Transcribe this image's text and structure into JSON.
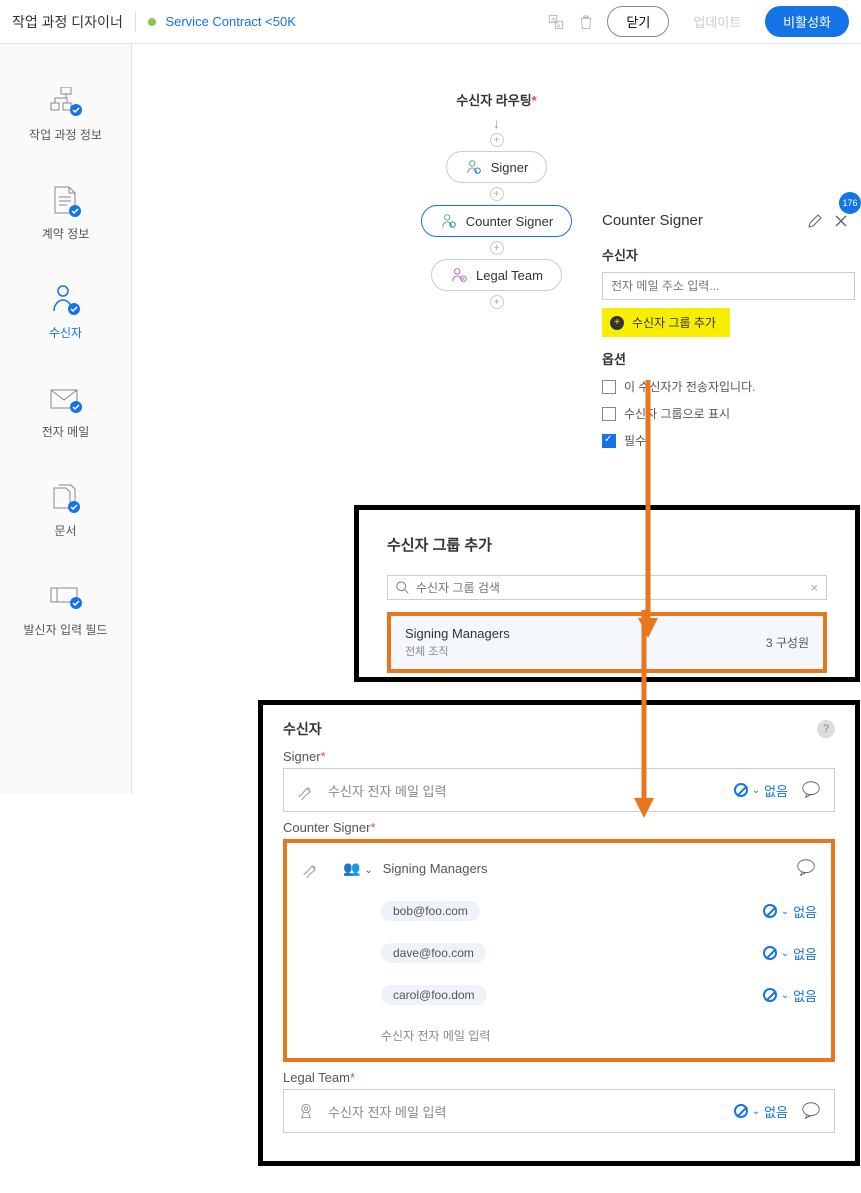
{
  "topbar": {
    "title": "작업 과정 디자이너",
    "service_name": "Service Contract <50K",
    "close_label": "닫기",
    "update_label": "업데이트",
    "disable_label": "비활성화"
  },
  "sidebar": {
    "items": [
      {
        "label": "작업 과정 정보"
      },
      {
        "label": "계약 정보"
      },
      {
        "label": "수신자"
      },
      {
        "label": "전자 메일"
      },
      {
        "label": "문서"
      },
      {
        "label": "발신자 입력 필드"
      }
    ]
  },
  "flow": {
    "title": "수신자 라우팅",
    "nodes": [
      {
        "label": "Signer"
      },
      {
        "label": "Counter Signer"
      },
      {
        "label": "Legal Team"
      }
    ]
  },
  "panel": {
    "title": "Counter Signer",
    "badge": "176",
    "recipient_label": "수신자",
    "email_placeholder": "전자 메일 주소 입력...",
    "add_group_label": "수신자 그룹 추가",
    "options_label": "옵션",
    "checkbox_sender": "이 수신자가 전송자입니다.",
    "checkbox_group": "수신자 그룹으로 표시",
    "checkbox_required": "필수"
  },
  "search_overlay": {
    "title": "수신자 그룹 추가",
    "placeholder": "수신자 그룹 검색",
    "result_name": "Signing Managers",
    "result_sub": "전체 조직",
    "result_count": "3 구성원"
  },
  "recip_overlay": {
    "title": "수신자",
    "sections": [
      {
        "label": "Signer",
        "placeholder": "수신자 전자 메일 입력",
        "auth": "없음"
      },
      {
        "label": "Counter Signer",
        "group_name": "Signing Managers",
        "members": [
          {
            "email": "bob@foo.com",
            "auth": "없음"
          },
          {
            "email": "dave@foo.com",
            "auth": "없음"
          },
          {
            "email": "carol@foo.dom",
            "auth": "없음"
          }
        ],
        "add_placeholder": "수신자 전자 메일 입력"
      },
      {
        "label": "Legal Team",
        "placeholder": "수신자 전자 메일 입력",
        "auth": "없음"
      }
    ]
  }
}
